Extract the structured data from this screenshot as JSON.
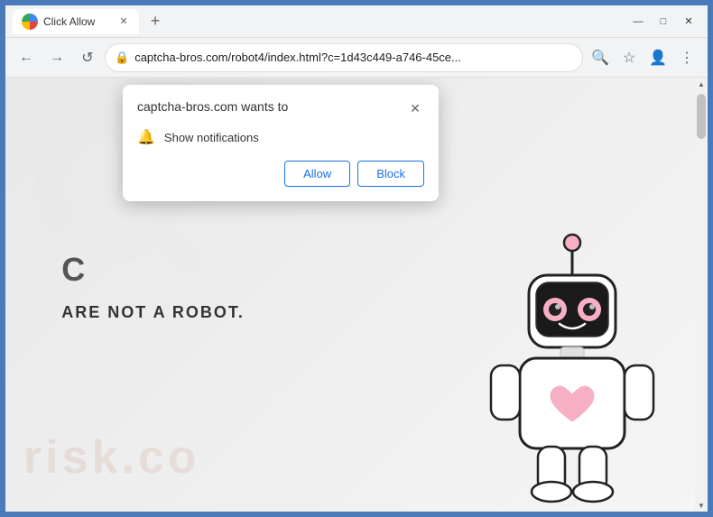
{
  "window": {
    "title": "Click Allow",
    "controls": {
      "minimize": "—",
      "maximize": "□",
      "close": "✕"
    }
  },
  "tab": {
    "icon": "globe",
    "label": "Click Allow",
    "close_btn": "✕"
  },
  "new_tab_btn": "+",
  "nav": {
    "back": "←",
    "forward": "→",
    "reload": "↺",
    "address": "captcha-bros.com/robot4/index.html?c=1d43c449-a746-45ce...",
    "address_short": "captcha-bros.com/robot4/index.html?c=1d43c449-a746-45ce...",
    "lock_icon": "🔒",
    "search_icon": "🔍",
    "star_icon": "☆",
    "profile_icon": "👤",
    "menu_icon": "⋮",
    "profile_arrow": "⌄"
  },
  "popup": {
    "title": "captcha-bros.com wants to",
    "close": "✕",
    "notification_label": "Show notifications",
    "allow_btn": "Allow",
    "block_btn": "Block"
  },
  "page": {
    "captcha_text1": "C",
    "captcha_text2": "ARE NOT A ROBOT.",
    "watermark1": "risk",
    "watermark2": "risk.co"
  },
  "scrollbar": {
    "up": "▲",
    "down": "▼"
  }
}
